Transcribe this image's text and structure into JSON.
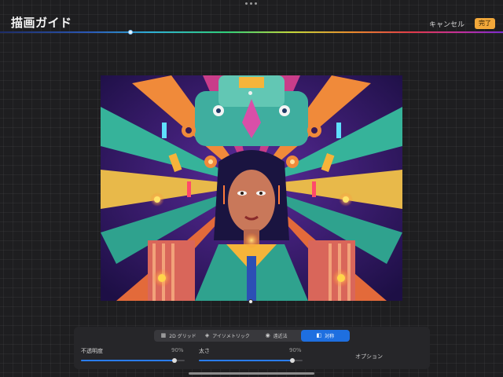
{
  "header": {
    "title": "描画ガイド",
    "cancel_label": "キャンセル",
    "done_label": "完了"
  },
  "guide_types": [
    {
      "label": "2D グリッド",
      "icon": "grid-icon",
      "active": false
    },
    {
      "label": "アイソメトリック",
      "icon": "isometric-icon",
      "active": false
    },
    {
      "label": "遠近法",
      "icon": "perspective-icon",
      "active": false
    },
    {
      "label": "対称",
      "icon": "symmetry-icon",
      "active": true
    }
  ],
  "sliders": {
    "opacity": {
      "label": "不透明度",
      "value_text": "90%",
      "value": 0.9
    },
    "thickness": {
      "label": "太さ",
      "value_text": "90%",
      "value": 0.9
    }
  },
  "options_label": "オプション",
  "colors": {
    "accent": "#1e6fe0",
    "done_button": "#f2a83a",
    "background": "#1e1e20"
  }
}
